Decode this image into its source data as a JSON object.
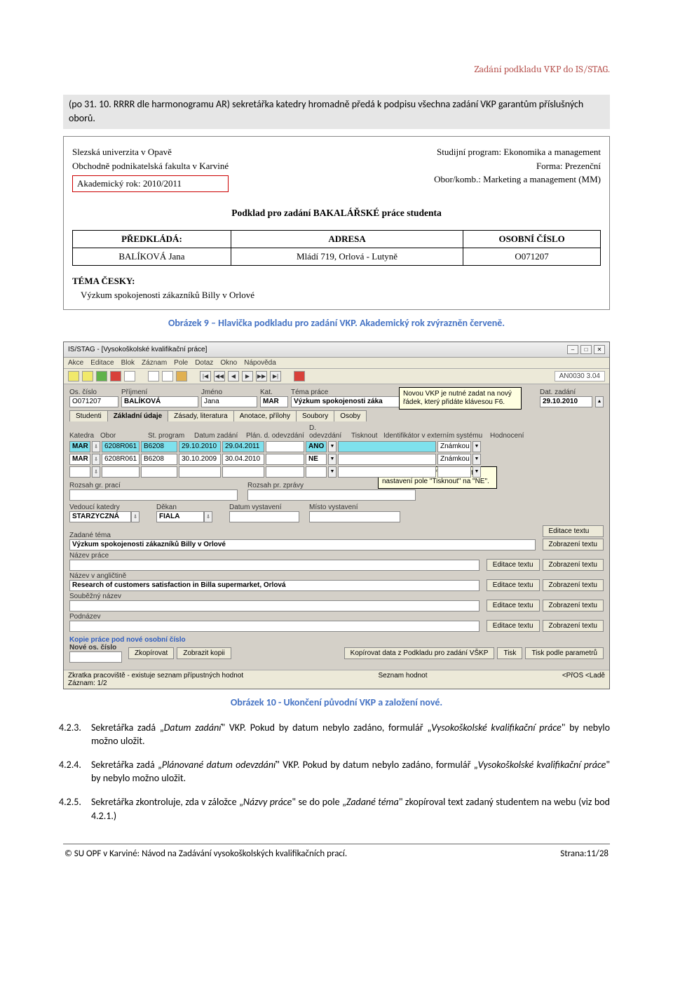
{
  "header": {
    "right": "Zadání podkladu VKP do IS/STAG."
  },
  "intro": {
    "text": "(po 31. 10. RRRR dle harmonogramu AR) sekretářka katedry hromadně předá k podpisu všechna zadání VKP garantům příslušných oborů."
  },
  "image1": {
    "left": [
      "Slezská univerzita v Opavě",
      "Obchodně podnikatelská fakulta v Karviné"
    ],
    "ak_rok": "Akademický rok: 2010/2011",
    "right": [
      "Studijní program: Ekonomika a management",
      "Forma: Prezenční",
      "Obor/komb.: Marketing a management (MM)"
    ],
    "title": "Podklad pro zadání BAKALÁŘSKÉ práce studenta",
    "th": [
      "PŘEDKLÁDÁ:",
      "ADRESA",
      "OSOBNÍ ČÍSLO"
    ],
    "td": [
      "BALÍKOVÁ Jana",
      "Mládí 719, Orlová - Lutyně",
      "O071207"
    ],
    "tema_lbl": "TÉMA ČESKY:",
    "tema_val": "Výzkum spokojenosti zákazníků Billy v Orlové"
  },
  "caption1": "Obrázek 9 – Hlavička podkladu pro zadání VKP. Akademický rok zvýrazněn červeně.",
  "app": {
    "title": "IS/STAG - [Vysokoškolské kvalifikační práce]",
    "menu": [
      "Akce",
      "Editace",
      "Blok",
      "Záznam",
      "Pole",
      "Dotaz",
      "Okno",
      "Nápověda"
    ],
    "tool_right": "AN0030  3.04",
    "row1_lbl": [
      "Os. číslo",
      "Příjmení",
      "Jméno",
      "Kat.",
      "Téma práce",
      "Dat. zadání"
    ],
    "row1_val": [
      "O071207",
      "BALÍKOVÁ",
      "Jana",
      "MAR",
      "Výzkum spokojenosti záka",
      "29.10.2010"
    ],
    "tip1": "Novou VKP je nutné zadat na nový řádek, který přidáte klávesou F6.",
    "tabs": [
      "Studenti",
      "Základní údaje",
      "Zásady, literatura",
      "Anotace, přílohy",
      "Soubory",
      "Osoby"
    ],
    "grid_hdr": [
      "Katedra",
      "Obor",
      "St. program",
      "Datum zadání",
      "Plán. d. odevzdání",
      "D. odevzdání",
      "Tisknout",
      "Identifikátor v externím systému",
      "Hodnocení"
    ],
    "grid_r1": [
      "MAR",
      "6208R061",
      "B6208",
      "29.10.2010",
      "29.04.2011",
      "",
      "ANO",
      "",
      "Známkou"
    ],
    "grid_r2": [
      "MAR",
      "6208R061",
      "B6208",
      "30.10.2009",
      "30.04.2010",
      "",
      "NE",
      "",
      "Známkou"
    ],
    "tip2": "Původní VKP je třeba ukončit nastavení pole \"Tisknout\" na \"NE\".",
    "lbl_rozsah1": "Rozsah gr. prací",
    "lbl_rozsah2": "Rozsah pr. zprávy",
    "lbl_vk": "Vedoucí katedry",
    "lbl_dekan": "Děkan",
    "lbl_dv": "Datum vystavení",
    "lbl_mv": "Místo vystavení",
    "val_vk": "STARZYCZNÁ",
    "val_dekan": "FIALA",
    "lbl_zt": "Zadané téma",
    "val_zt": "Výzkum spokojenosti zákazníků Billy v Orlové",
    "lbl_np": "Název práce",
    "lbl_na": "Název v angličtině",
    "val_na": "Research of customers satisfaction in Billa supermarket, Orlová",
    "lbl_sn": "Souběžný název",
    "lbl_pn": "Podnázev",
    "btn_edit": "Editace textu",
    "btn_zobr": "Zobrazení textu",
    "kopie_lbl": "Kopie práce pod nové osobní číslo",
    "nove_os": "Nové os. číslo",
    "btn_zkop": "Zkopírovat",
    "btn_zk": "Zobrazit kopii",
    "btn_kop": "Kopírovat data z Podkladu pro zadání VŠKP",
    "btn_tisk": "Tisk",
    "btn_tiskp": "Tisk podle parametrů",
    "status_l1": "Zkratka pracoviště - existuje seznam přípustných hodnot",
    "status_l2": "Záznam: 1/2",
    "status_mid": "Seznam hodnot",
    "status_r": "<PřOS  <Ladě"
  },
  "caption2": "Obrázek 10 - Ukončení původní VKP a založení nové.",
  "items": [
    {
      "num": "4.2.3.",
      "html": "Sekretářka zadá „<i>Datum zadání</i>\" VKP. Pokud by datum nebylo zadáno, formulář „<i>Vysokoškolské kvalifikační práce</i>\" by nebylo možno uložit."
    },
    {
      "num": "4.2.4.",
      "html": "Sekretářka zadá „<i>Plánované datum odevzdání</i>\" VKP. Pokud by datum nebylo zadáno, formulář „<i>Vysokoškolské kvalifikační práce</i>\" by nebylo možno uložit."
    },
    {
      "num": "4.2.5.",
      "html": "Sekretářka zkontroluje, zda v záložce „<i>Názvy práce</i>\" se do pole „<i>Zadané téma</i>\" zkopíroval text zadaný studentem na webu (viz bod 4.2.1.)"
    }
  ],
  "footer": {
    "left": "© SU OPF v Karviné: Návod na Zadávání vysokoškolských kvalifikačních prací.",
    "right": "Strana:11/28"
  }
}
